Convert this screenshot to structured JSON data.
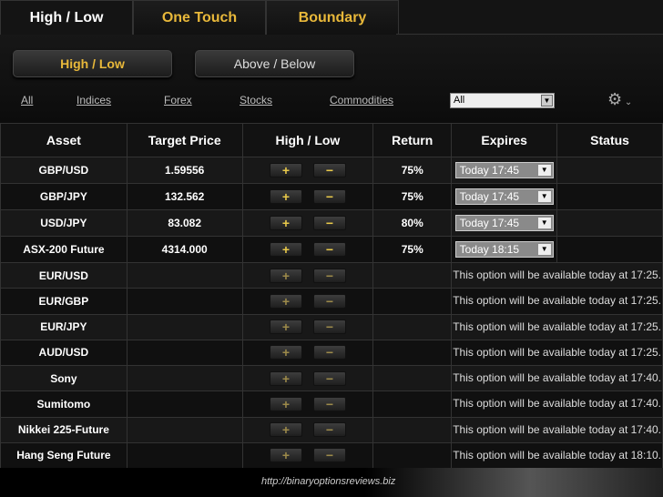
{
  "tabs": [
    "High / Low",
    "One Touch",
    "Boundary"
  ],
  "subtabs": {
    "high_low": "High / Low",
    "above_below": "Above / Below"
  },
  "filters": [
    "All",
    "Indices",
    "Forex",
    "Stocks",
    "Commodities"
  ],
  "select": {
    "value": "All"
  },
  "icons": {
    "settings": "gear-icon",
    "dropdown": "chevron-down-icon"
  },
  "colors": {
    "accent": "#e8b83a"
  },
  "table": {
    "headers": [
      "Asset",
      "Target Price",
      "High / Low",
      "Return",
      "Expires",
      "Status"
    ],
    "plus": "+",
    "minus": "−",
    "rows": [
      {
        "asset": "GBP/USD",
        "target": "1.59556",
        "return": "75%",
        "expires": "Today 17:45"
      },
      {
        "asset": "GBP/JPY",
        "target": "132.562",
        "return": "75%",
        "expires": "Today 17:45"
      },
      {
        "asset": "USD/JPY",
        "target": "83.082",
        "return": "80%",
        "expires": "Today 17:45"
      },
      {
        "asset": "ASX-200 Future",
        "target": "4314.000",
        "return": "75%",
        "expires": "Today 18:15"
      },
      {
        "asset": "EUR/USD",
        "message": "This option will be available today at 17:25."
      },
      {
        "asset": "EUR/GBP",
        "message": "This option will be available today at 17:25."
      },
      {
        "asset": "EUR/JPY",
        "message": "This option will be available today at 17:25."
      },
      {
        "asset": "AUD/USD",
        "message": "This option will be available today at 17:25."
      },
      {
        "asset": "Sony",
        "message": "This option will be available today at 17:40."
      },
      {
        "asset": "Sumitomo",
        "message": "This option will be available today at 17:40."
      },
      {
        "asset": "Nikkei 225-Future",
        "message": "This option will be available today at 17:40."
      },
      {
        "asset": "Hang Seng Future",
        "message": "This option will be available today at 18:10."
      }
    ]
  },
  "footer": "http://binaryoptionsreviews.biz"
}
